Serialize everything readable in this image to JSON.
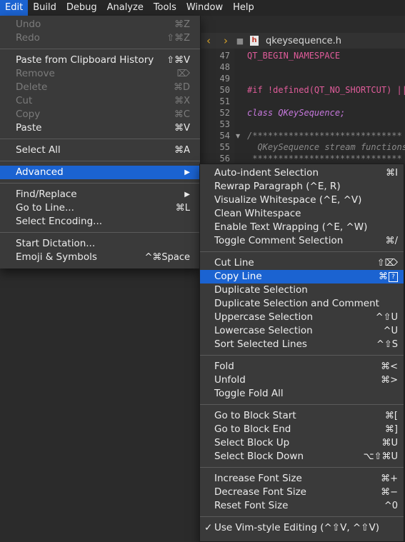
{
  "menubar": {
    "items": [
      "Edit",
      "Build",
      "Debug",
      "Analyze",
      "Tools",
      "Window",
      "Help"
    ],
    "active": "Edit"
  },
  "editor": {
    "nav_back": "‹",
    "nav_forward": "›",
    "lock_icon": "lock-icon",
    "file_icon_letter": "h",
    "filename": "qkeysequence.h",
    "lines": [
      {
        "num": "47",
        "text": "QT_BEGIN_NAMESPACE",
        "color": "#e05c9a"
      },
      {
        "num": "48",
        "text": "",
        "color": "#e8e8e8"
      },
      {
        "num": "49",
        "text": "",
        "color": "#e8e8e8"
      },
      {
        "num": "50",
        "text": "#if !defined(QT_NO_SHORTCUT) ||",
        "color": "#e05c9a"
      },
      {
        "num": "51",
        "text": "",
        "color": "#e8e8e8"
      },
      {
        "num": "52",
        "text": "class QKeySequence;",
        "color": "#c678dd"
      },
      {
        "num": "53",
        "text": "",
        "color": "#e8e8e8"
      },
      {
        "num": "54",
        "text": "/*****************************",
        "color": "#8a8a8a"
      },
      {
        "num": "55",
        "text": "  QKeySequence stream functions",
        "color": "#8a8a8a"
      },
      {
        "num": "56",
        "text": " *****************************",
        "color": "#8a8a8a"
      }
    ]
  },
  "edit_menu": {
    "undo": {
      "label": "Undo",
      "shortcut": "⌘Z"
    },
    "redo": {
      "label": "Redo",
      "shortcut": "⇧⌘Z"
    },
    "paste_history": {
      "label": "Paste from Clipboard History",
      "shortcut": "⇧⌘V"
    },
    "remove": {
      "label": "Remove",
      "shortcut": "⌦"
    },
    "delete": {
      "label": "Delete",
      "shortcut": "⌘D"
    },
    "cut": {
      "label": "Cut",
      "shortcut": "⌘X"
    },
    "copy": {
      "label": "Copy",
      "shortcut": "⌘C"
    },
    "paste": {
      "label": "Paste",
      "shortcut": "⌘V"
    },
    "select_all": {
      "label": "Select All",
      "shortcut": "⌘A"
    },
    "advanced": {
      "label": "Advanced",
      "arrow": "▶"
    },
    "find_replace": {
      "label": "Find/Replace",
      "arrow": "▶"
    },
    "go_to_line": {
      "label": "Go to Line...",
      "shortcut": "⌘L"
    },
    "select_encoding": {
      "label": "Select Encoding..."
    },
    "start_dictation": {
      "label": "Start Dictation..."
    },
    "emoji_symbols": {
      "label": "Emoji & Symbols",
      "shortcut": "^⌘Space"
    }
  },
  "advanced_menu": {
    "auto_indent": {
      "label": "Auto-indent Selection",
      "shortcut": "⌘I"
    },
    "rewrap": {
      "label": "Rewrap Paragraph (^E, R)",
      "shortcut": ""
    },
    "visualize_ws": {
      "label": "Visualize Whitespace (^E, ^V)",
      "shortcut": ""
    },
    "clean_ws": {
      "label": "Clean Whitespace",
      "shortcut": ""
    },
    "text_wrapping": {
      "label": "Enable Text Wrapping (^E, ^W)",
      "shortcut": ""
    },
    "toggle_comment": {
      "label": "Toggle Comment Selection",
      "shortcut": "⌘/"
    },
    "cut_line": {
      "label": "Cut Line",
      "shortcut": "⇧⌦"
    },
    "copy_line": {
      "label": "Copy Line",
      "shortcut": "⌘"
    },
    "duplicate_sel": {
      "label": "Duplicate Selection",
      "shortcut": ""
    },
    "duplicate_sel_comment": {
      "label": "Duplicate Selection and Comment",
      "shortcut": ""
    },
    "uppercase": {
      "label": "Uppercase Selection",
      "shortcut": "^⇧U"
    },
    "lowercase": {
      "label": "Lowercase Selection",
      "shortcut": "^U"
    },
    "sort_lines": {
      "label": "Sort Selected Lines",
      "shortcut": "^⇧S"
    },
    "fold": {
      "label": "Fold",
      "shortcut": "⌘<"
    },
    "unfold": {
      "label": "Unfold",
      "shortcut": "⌘>"
    },
    "toggle_fold_all": {
      "label": "Toggle Fold All",
      "shortcut": ""
    },
    "block_start": {
      "label": "Go to Block Start",
      "shortcut": "⌘["
    },
    "block_end": {
      "label": "Go to Block End",
      "shortcut": "⌘]"
    },
    "block_up": {
      "label": "Select Block Up",
      "shortcut": "⌘U"
    },
    "block_down": {
      "label": "Select Block Down",
      "shortcut": "⌥⇧⌘U"
    },
    "font_inc": {
      "label": "Increase Font Size",
      "shortcut": "⌘+"
    },
    "font_dec": {
      "label": "Decrease Font Size",
      "shortcut": "⌘−"
    },
    "font_reset": {
      "label": "Reset Font Size",
      "shortcut": "^0"
    },
    "vim": {
      "label": "Use Vim-style Editing (^⇧V, ^⇧V)",
      "check": "✓"
    }
  }
}
